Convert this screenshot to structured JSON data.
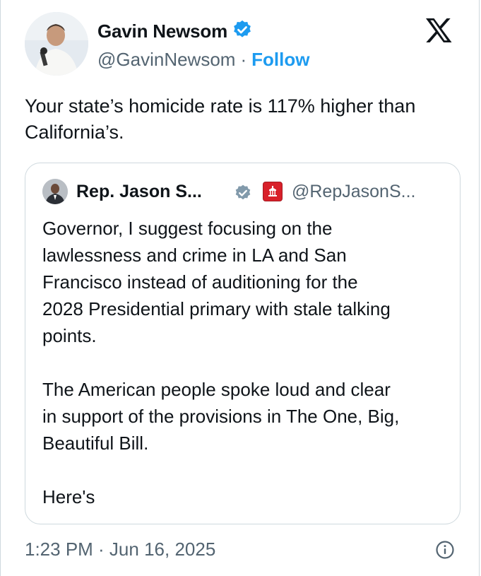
{
  "tweet": {
    "author_name": "Gavin Newsom",
    "author_handle": "@GavinNewsom",
    "separator": "·",
    "follow_label": "Follow",
    "text": "Your state’s homicide rate is 117% higher than\nCalifornia’s.",
    "timestamp": "1:23 PM · Jun 16, 2025"
  },
  "quoted_tweet": {
    "author_name": "Rep. Jason S...",
    "author_handle": "@RepJasonS...",
    "text": "Governor, I suggest focusing on the\nlawlessness and crime in LA and San\nFrancisco instead of auditioning for the\n2028 Presidential primary with stale talking\npoints.\n\nThe American people spoke loud and clear\nin support of the provisions in The One, Big,\nBeautiful Bill.\n\nHere's"
  },
  "icons": {
    "verified_blue": "verified-badge-icon",
    "verified_gray": "verified-gray-badge-icon",
    "government_flag": "capitol-flag-icon",
    "brand": "x-logo-icon",
    "info": "info-icon"
  },
  "colors": {
    "accent": "#1d9bf0",
    "text": "#0f1419",
    "muted": "#536471",
    "border": "#cfd9de",
    "gov_badge": "#d8202a",
    "gray_badge": "#829aab"
  }
}
